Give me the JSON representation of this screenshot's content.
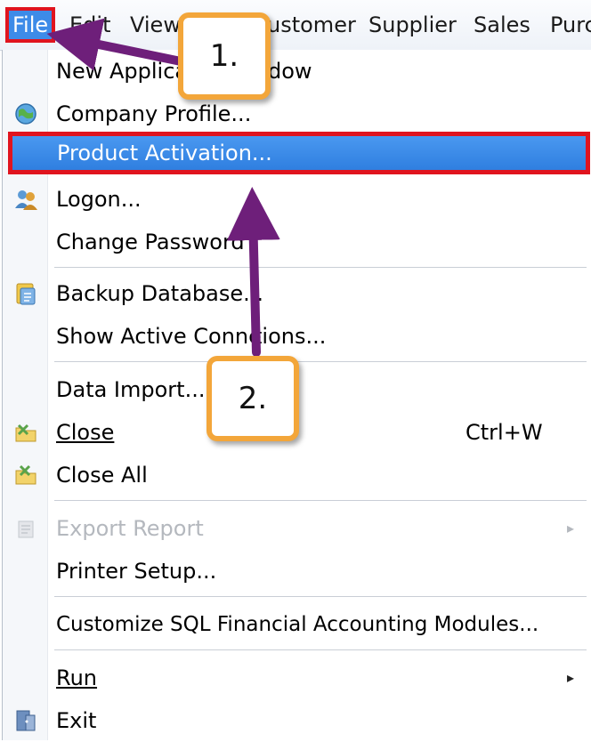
{
  "menubar": {
    "items": [
      {
        "label": "File",
        "mnemonic": "F"
      },
      {
        "label": "Edit",
        "mnemonic": "E"
      },
      {
        "label": "View",
        "mnemonic": "V"
      },
      {
        "label": "ustomer"
      },
      {
        "label": "Supplier",
        "mnemonic": "u"
      },
      {
        "label": "Sales",
        "mnemonic": "S"
      },
      {
        "label": "Purc"
      }
    ]
  },
  "file_menu": {
    "items": [
      {
        "label": "New Applica",
        "tail": "dow",
        "icon": "none"
      },
      {
        "label": "Company Profile...",
        "icon": "globe-icon"
      },
      {
        "label": "Product Activation...",
        "icon": "none"
      },
      {
        "label": "Logon...",
        "icon": "users-icon"
      },
      {
        "label": "Change Password",
        "icon": "none"
      },
      {
        "label": "Backup Database...",
        "icon": "database-icon"
      },
      {
        "label": "Show Active Conne",
        "tail": "tions...",
        "icon": "none"
      },
      {
        "label": "Data Import...",
        "icon": "none"
      },
      {
        "label": "Close",
        "shortcut": "Ctrl+W",
        "icon": "close-folder-icon"
      },
      {
        "label": "Close All",
        "icon": "close-all-folder-icon"
      },
      {
        "label": "Export Report",
        "icon": "export-icon",
        "disabled": true,
        "submenu": "▸"
      },
      {
        "label": "Printer Setup...",
        "icon": "none"
      },
      {
        "label": "Customize SQL Financial Accounting Modules...",
        "icon": "none"
      },
      {
        "label": "Run",
        "icon": "none",
        "submenu": "▸"
      },
      {
        "label": "Exit",
        "icon": "exit-icon"
      }
    ]
  },
  "callouts": {
    "step1": "1.",
    "step2": "2."
  },
  "colors": {
    "highlight_blue": "#3d8be8",
    "annotation_red": "#e0141e",
    "arrow_purple": "#6e1f7a",
    "callout_orange": "#f3a63a"
  }
}
